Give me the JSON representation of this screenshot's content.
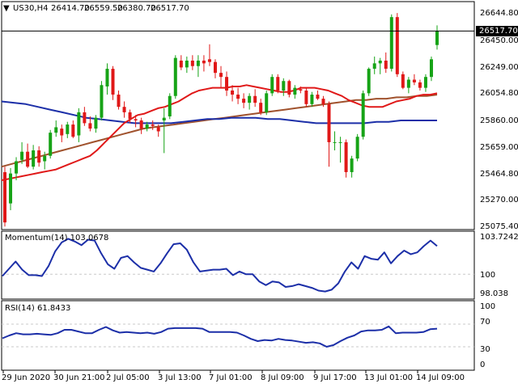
{
  "header": {
    "symbol": "US30,H4",
    "open": "26414.70",
    "high": "26559.50",
    "low": "26380.70",
    "close": "26517.70"
  },
  "current_price_label": "26517.70",
  "price_axis": [
    "26644.80",
    "26450.00",
    "26249.00",
    "26054.80",
    "25860.00",
    "25659.00",
    "25464.80",
    "25270.00",
    "25075.40"
  ],
  "momentum_panel": {
    "label": "Momentum(14) 103.0678",
    "axis": [
      "103.7242",
      "100",
      "98.038"
    ]
  },
  "rsi_panel": {
    "label": "RSI(14) 61.8433",
    "axis": [
      "100",
      "70",
      "30",
      "0"
    ]
  },
  "time_axis": [
    "29 Jun 2020",
    "30 Jun 21:00",
    "2 Jul 05:00",
    "3 Jul 13:00",
    "7 Jul 01:00",
    "8 Jul 09:00",
    "9 Jul 17:00",
    "13 Jul 01:00",
    "14 Jul 09:00"
  ],
  "colors": {
    "bull": "#16a316",
    "bear": "#e01818",
    "sma_fast": "#e01818",
    "sma_mid": "#a0522d",
    "sma_slow": "#1c2fa8",
    "indicator": "#1c2fa8",
    "grid": "#c8c8c8"
  },
  "chart_data": {
    "type": "candlestick",
    "title": "US30,H4",
    "ylim": [
      25075.4,
      26700
    ],
    "candles": [
      {
        "o": 25480,
        "h": 25520,
        "l": 25080,
        "c": 25110
      },
      {
        "o": 25250,
        "h": 25510,
        "l": 25200,
        "c": 25470
      },
      {
        "o": 25470,
        "h": 25590,
        "l": 25420,
        "c": 25560
      },
      {
        "o": 25570,
        "h": 25700,
        "l": 25540,
        "c": 25630
      },
      {
        "o": 25630,
        "h": 25690,
        "l": 25510,
        "c": 25520
      },
      {
        "o": 25520,
        "h": 25680,
        "l": 25500,
        "c": 25640
      },
      {
        "o": 25640,
        "h": 25670,
        "l": 25520,
        "c": 25550
      },
      {
        "o": 25560,
        "h": 25630,
        "l": 25500,
        "c": 25600
      },
      {
        "o": 25600,
        "h": 25790,
        "l": 25580,
        "c": 25770
      },
      {
        "o": 25770,
        "h": 25860,
        "l": 25740,
        "c": 25810
      },
      {
        "o": 25800,
        "h": 25830,
        "l": 25700,
        "c": 25750
      },
      {
        "o": 25760,
        "h": 25850,
        "l": 25730,
        "c": 25830
      },
      {
        "o": 25830,
        "h": 25860,
        "l": 25730,
        "c": 25740
      },
      {
        "o": 25750,
        "h": 25950,
        "l": 25700,
        "c": 25920
      },
      {
        "o": 25920,
        "h": 25960,
        "l": 25820,
        "c": 25840
      },
      {
        "o": 25840,
        "h": 25890,
        "l": 25780,
        "c": 25800
      },
      {
        "o": 25800,
        "h": 25900,
        "l": 25770,
        "c": 25880
      },
      {
        "o": 25880,
        "h": 26150,
        "l": 25860,
        "c": 26120
      },
      {
        "o": 26110,
        "h": 26280,
        "l": 26050,
        "c": 26240
      },
      {
        "o": 26240,
        "h": 26260,
        "l": 26010,
        "c": 26050
      },
      {
        "o": 26050,
        "h": 26080,
        "l": 25940,
        "c": 25960
      },
      {
        "o": 25960,
        "h": 26000,
        "l": 25880,
        "c": 25920
      },
      {
        "o": 25920,
        "h": 25940,
        "l": 25840,
        "c": 25870
      },
      {
        "o": 25870,
        "h": 25900,
        "l": 25810,
        "c": 25860
      },
      {
        "o": 25860,
        "h": 25880,
        "l": 25760,
        "c": 25800
      },
      {
        "o": 25800,
        "h": 25850,
        "l": 25780,
        "c": 25830
      },
      {
        "o": 25830,
        "h": 25860,
        "l": 25790,
        "c": 25820
      },
      {
        "o": 25810,
        "h": 25830,
        "l": 25740,
        "c": 25780
      },
      {
        "o": 25860,
        "h": 25950,
        "l": 25620,
        "c": 25880
      },
      {
        "o": 25890,
        "h": 26060,
        "l": 25870,
        "c": 26040
      },
      {
        "o": 26040,
        "h": 26340,
        "l": 26020,
        "c": 26320
      },
      {
        "o": 26300,
        "h": 26340,
        "l": 26230,
        "c": 26250
      },
      {
        "o": 26250,
        "h": 26330,
        "l": 26210,
        "c": 26300
      },
      {
        "o": 26300,
        "h": 26340,
        "l": 26230,
        "c": 26260
      },
      {
        "o": 26260,
        "h": 26340,
        "l": 26180,
        "c": 26300
      },
      {
        "o": 26300,
        "h": 26340,
        "l": 26220,
        "c": 26280
      },
      {
        "o": 26310,
        "h": 26420,
        "l": 26260,
        "c": 26290
      },
      {
        "o": 26290,
        "h": 26310,
        "l": 26170,
        "c": 26210
      },
      {
        "o": 26210,
        "h": 26260,
        "l": 26100,
        "c": 26180
      },
      {
        "o": 26180,
        "h": 26220,
        "l": 26040,
        "c": 26080
      },
      {
        "o": 26080,
        "h": 26120,
        "l": 26000,
        "c": 26050
      },
      {
        "o": 26050,
        "h": 26100,
        "l": 25980,
        "c": 26020
      },
      {
        "o": 26020,
        "h": 26060,
        "l": 25950,
        "c": 25990
      },
      {
        "o": 25990,
        "h": 26060,
        "l": 25940,
        "c": 26040
      },
      {
        "o": 26040,
        "h": 26090,
        "l": 25960,
        "c": 25990
      },
      {
        "o": 25990,
        "h": 26020,
        "l": 25900,
        "c": 25920
      },
      {
        "o": 25920,
        "h": 26080,
        "l": 25900,
        "c": 26060
      },
      {
        "o": 26060,
        "h": 26200,
        "l": 26040,
        "c": 26180
      },
      {
        "o": 26180,
        "h": 26200,
        "l": 26060,
        "c": 26080
      },
      {
        "o": 26080,
        "h": 26170,
        "l": 26040,
        "c": 26150
      },
      {
        "o": 26150,
        "h": 26160,
        "l": 26030,
        "c": 26050
      },
      {
        "o": 26050,
        "h": 26120,
        "l": 26020,
        "c": 26100
      },
      {
        "o": 26090,
        "h": 26110,
        "l": 26060,
        "c": 26080
      },
      {
        "o": 26080,
        "h": 26100,
        "l": 25960,
        "c": 25980
      },
      {
        "o": 25980,
        "h": 26070,
        "l": 25960,
        "c": 26050
      },
      {
        "o": 26050,
        "h": 26080,
        "l": 26010,
        "c": 26020
      },
      {
        "o": 26020,
        "h": 26040,
        "l": 25960,
        "c": 25980
      },
      {
        "o": 25980,
        "h": 26000,
        "l": 25520,
        "c": 25700
      },
      {
        "o": 25700,
        "h": 25780,
        "l": 25640,
        "c": 25700
      },
      {
        "o": 25700,
        "h": 25740,
        "l": 25550,
        "c": 25700
      },
      {
        "o": 25700,
        "h": 25720,
        "l": 25440,
        "c": 25480
      },
      {
        "o": 25480,
        "h": 25600,
        "l": 25440,
        "c": 25580
      },
      {
        "o": 25580,
        "h": 25760,
        "l": 25560,
        "c": 25740
      },
      {
        "o": 25740,
        "h": 26080,
        "l": 25720,
        "c": 26060
      },
      {
        "o": 26060,
        "h": 26250,
        "l": 26040,
        "c": 26240
      },
      {
        "o": 26240,
        "h": 26330,
        "l": 26200,
        "c": 26280
      },
      {
        "o": 26280,
        "h": 26320,
        "l": 26200,
        "c": 26300
      },
      {
        "o": 26300,
        "h": 26360,
        "l": 26210,
        "c": 26240
      },
      {
        "o": 26240,
        "h": 26640,
        "l": 26220,
        "c": 26620
      },
      {
        "o": 26620,
        "h": 26650,
        "l": 26180,
        "c": 26200
      },
      {
        "o": 26200,
        "h": 26220,
        "l": 26090,
        "c": 26100
      },
      {
        "o": 26100,
        "h": 26180,
        "l": 26060,
        "c": 26160
      },
      {
        "o": 26160,
        "h": 26200,
        "l": 26120,
        "c": 26140
      },
      {
        "o": 26140,
        "h": 26160,
        "l": 26080,
        "c": 26100
      },
      {
        "o": 26100,
        "h": 26200,
        "l": 26070,
        "c": 26180
      },
      {
        "o": 26180,
        "h": 26330,
        "l": 26150,
        "c": 26310
      },
      {
        "o": 26414.7,
        "h": 26559.5,
        "l": 26380.7,
        "c": 26517.7
      }
    ],
    "sma_fast": [
      25420,
      25430,
      25440,
      25450,
      25460,
      25470,
      25480,
      25490,
      25500,
      25520,
      25540,
      25560,
      25580,
      25600,
      25640,
      25690,
      25740,
      25790,
      25840,
      25870,
      25900,
      25910,
      25930,
      25950,
      25960,
      25980,
      26000,
      26030,
      26060,
      26080,
      26090,
      26100,
      26100,
      26100,
      26110,
      26110,
      26120,
      26110,
      26100,
      26090,
      26080,
      26070,
      26070,
      26080,
      26100,
      26100,
      26100,
      26090,
      26080,
      26060,
      26040,
      26010,
      25990,
      25970,
      25960,
      25960,
      25960,
      25980,
      26000,
      26010,
      26020,
      26040,
      26050,
      26050,
      26060
    ],
    "sma_mid": [
      25520,
      25540,
      25560,
      25580,
      25600,
      25620,
      25640,
      25660,
      25680,
      25700,
      25720,
      25740,
      25760,
      25780,
      25800,
      25810,
      25820,
      25830,
      25840,
      25850,
      25860,
      25870,
      25880,
      25890,
      25900,
      25910,
      25920,
      25930,
      25940,
      25950,
      25960,
      25970,
      25980,
      25990,
      26000,
      26010,
      26010,
      26020,
      26020,
      26030,
      26030,
      26040,
      26040,
      26050
    ],
    "sma_slow": [
      26000,
      25990,
      25980,
      25960,
      25940,
      25920,
      25900,
      25880,
      25870,
      25860,
      25850,
      25840,
      25840,
      25840,
      25840,
      25850,
      25860,
      25870,
      25870,
      25880,
      25880,
      25880,
      25870,
      25870,
      25860,
      25850,
      25840,
      25840,
      25840,
      25840,
      25840,
      25850,
      25850,
      25860,
      25860,
      25860,
      25860
    ],
    "momentum": {
      "ylim": [
        97.8,
        104.2
      ],
      "values": [
        99.8,
        100.6,
        101.4,
        100.5,
        99.9,
        99.9,
        99.8,
        100.9,
        102.5,
        103.5,
        103.9,
        103.6,
        103.2,
        103.8,
        103.7,
        102.3,
        101.1,
        100.6,
        101.8,
        102.0,
        101.3,
        100.7,
        100.5,
        100.3,
        101.2,
        102.3,
        103.3,
        103.4,
        102.7,
        101.3,
        100.3,
        100.4,
        100.5,
        100.5,
        100.6,
        99.9,
        100.3,
        100.0,
        100.0,
        99.2,
        98.8,
        99.2,
        99.1,
        98.6,
        98.7,
        98.9,
        98.7,
        98.5,
        98.2,
        98.1,
        98.3,
        99.0,
        100.3,
        101.3,
        100.6,
        102.0,
        101.7,
        101.6,
        102.4,
        101.2,
        102.0,
        102.6,
        102.2,
        102.4,
        103.1,
        103.7,
        103.1
      ]
    },
    "rsi": {
      "ylim": [
        0,
        100
      ],
      "values": [
        45,
        50,
        54,
        52,
        52,
        53,
        52,
        51,
        54,
        60,
        60,
        57,
        54,
        54,
        60,
        65,
        59,
        55,
        56,
        55,
        54,
        55,
        53,
        56,
        62,
        63,
        63,
        63,
        63,
        62,
        56,
        56,
        56,
        56,
        55,
        50,
        44,
        40,
        42,
        41,
        44,
        42,
        41,
        39,
        37,
        38,
        36,
        30,
        33,
        40,
        46,
        50,
        57,
        59,
        59,
        60,
        66,
        54,
        55,
        55,
        55,
        56,
        61,
        62
      ]
    }
  }
}
